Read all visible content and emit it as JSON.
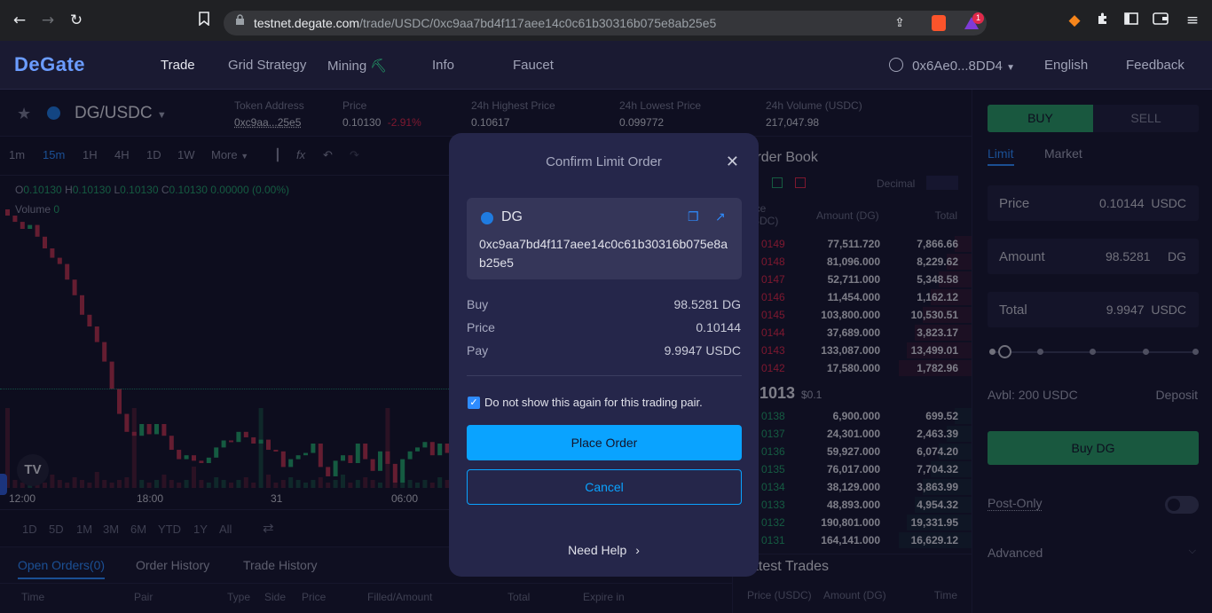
{
  "browser": {
    "url_host": "testnet.degate.com",
    "url_path": "/trade/USDC/0xc9aa7bd4f117aee14c0c61b30316b075e8ab25e5",
    "badge_count": "1"
  },
  "nav": {
    "logo": "DeGate",
    "items": [
      "Trade",
      "Grid Strategy",
      "Mining",
      "Info",
      "Faucet"
    ],
    "account": "0x6Ae0...8DD4",
    "language": "English",
    "feedback": "Feedback"
  },
  "pair": {
    "name": "DG/USDC",
    "token_address_label": "Token Address",
    "token_address": "0xc9aa...25e5",
    "price_label": "Price",
    "price": "0.10130",
    "change": "-2.91%",
    "high_label": "24h Highest Price",
    "high": "0.10617",
    "low_label": "24h Lowest Price",
    "low": "0.099772",
    "volume_label": "24h Volume (USDC)",
    "volume": "217,047.98"
  },
  "chart": {
    "timeframes": [
      "1m",
      "15m",
      "1H",
      "4H",
      "1D",
      "1W",
      "More"
    ],
    "active_timeframe": "15m",
    "ohlc": {
      "O": "0.10130",
      "H": "0.10130",
      "L": "0.10130",
      "C": "0.10130",
      "change": "0.00000 (0.00%)"
    },
    "volume_label": "Volume",
    "volume_value": "0",
    "x_ticks": [
      "12:00",
      "18:00",
      "31",
      "06:00"
    ],
    "ranges": [
      "1D",
      "5D",
      "1M",
      "3M",
      "6M",
      "YTD",
      "1Y",
      "All"
    ]
  },
  "orders": {
    "tabs": [
      "Open Orders(0)",
      "Order History",
      "Trade History"
    ],
    "columns": [
      "Time",
      "Pair",
      "Type",
      "Side",
      "Price",
      "Filled/Amount",
      "Total",
      "Expire in"
    ]
  },
  "orderbook": {
    "title": "Order Book",
    "decimal_label": "Decimal",
    "col_price": "Price (USDC)",
    "col_price_a": "ice",
    "col_price_b": "SDC)",
    "col_amount": "Amount (DG)",
    "col_total": "Total",
    "asks": [
      {
        "price": "0149",
        "amount": "77,511.720",
        "total": "7,866.66"
      },
      {
        "price": "0148",
        "amount": "81,096.000",
        "total": "8,229.62"
      },
      {
        "price": "0147",
        "amount": "52,711.000",
        "total": "5,348.58"
      },
      {
        "price": "0146",
        "amount": "11,454.000",
        "total": "1,162.12"
      },
      {
        "price": "0145",
        "amount": "103,800.000",
        "total": "10,530.51"
      },
      {
        "price": "0144",
        "amount": "37,689.000",
        "total": "3,823.17"
      },
      {
        "price": "0143",
        "amount": "133,087.000",
        "total": "13,499.01"
      },
      {
        "price": "0142",
        "amount": "17,580.000",
        "total": "1,782.96"
      }
    ],
    "mid_price": "1013",
    "mid_usd": "$0.1",
    "bids": [
      {
        "price": "0138",
        "amount": "6,900.000",
        "total": "699.52"
      },
      {
        "price": "0137",
        "amount": "24,301.000",
        "total": "2,463.39"
      },
      {
        "price": "0136",
        "amount": "59,927.000",
        "total": "6,074.20"
      },
      {
        "price": "0135",
        "amount": "76,017.000",
        "total": "7,704.32"
      },
      {
        "price": "0134",
        "amount": "38,129.000",
        "total": "3,863.99"
      },
      {
        "price": "0133",
        "amount": "48,893.000",
        "total": "4,954.32"
      },
      {
        "price": "0132",
        "amount": "190,801.000",
        "total": "19,331.95"
      },
      {
        "price": "0131",
        "amount": "164,141.000",
        "total": "16,629.12"
      }
    ],
    "latest_title": "atest Trades",
    "latest_cols": [
      "Price (USDC)",
      "Amount (DG)",
      "Time"
    ]
  },
  "trade_panel": {
    "buy_tab": "BUY",
    "sell_tab": "SELL",
    "limit_tab": "Limit",
    "market_tab": "Market",
    "price_label": "Price",
    "price_value": "0.10144",
    "price_unit": "USDC",
    "amount_label": "Amount",
    "amount_value": "98.5281",
    "amount_unit": "DG",
    "total_label": "Total",
    "total_value": "9.9947",
    "total_unit": "USDC",
    "available": "Avbl: 200 USDC",
    "deposit": "Deposit",
    "buy_button": "Buy DG",
    "post_only": "Post-Only",
    "advanced": "Advanced"
  },
  "modal": {
    "title": "Confirm Limit Order",
    "token_symbol": "DG",
    "token_address": "0xc9aa7bd4f117aee14c0c61b30316b075e8ab25e5",
    "buy_label": "Buy",
    "buy_value": "98.5281 DG",
    "price_label": "Price",
    "price_value": "0.10144",
    "pay_label": "Pay",
    "pay_value": "9.9947 USDC",
    "checkbox_label": "Do not show this again for this trading pair.",
    "checkbox_checked": true,
    "place_order": "Place Order",
    "cancel": "Cancel",
    "need_help": "Need Help"
  },
  "colors": {
    "accent": "#0aa3ff",
    "up": "#23a26b",
    "down": "#e0294a",
    "bg": "#14142b"
  }
}
